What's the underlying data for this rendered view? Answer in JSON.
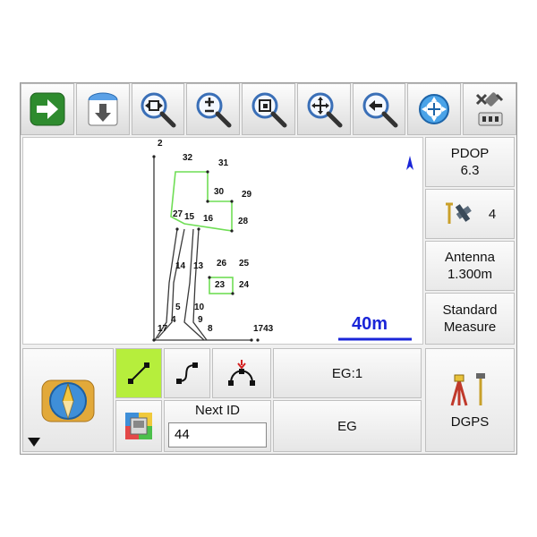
{
  "toolbar": {
    "icons": [
      "exit-arrow-icon",
      "download-icon",
      "zoom-extents-icon",
      "zoom-in-out-icon",
      "zoom-window-icon",
      "pan-icon",
      "zoom-previous-icon",
      "gps-center-icon",
      "gps-settings-icon"
    ]
  },
  "map": {
    "north_marker": "north-arrow-icon",
    "scale_label": "40m",
    "point_labels": [
      "2",
      "32",
      "31",
      "30",
      "29",
      "27",
      "15",
      "16",
      "28",
      "14",
      "13",
      "26",
      "25",
      "23",
      "24",
      "5",
      "10",
      "4",
      "9",
      "17",
      "8",
      "1743"
    ]
  },
  "status": {
    "pdop_label": "PDOP",
    "pdop_value": "6.3",
    "satellite_count": "4",
    "antenna_label": "Antenna",
    "antenna_value": "1.300m",
    "measure_line1": "Standard",
    "measure_line2": "Measure",
    "dgps_label": "DGPS"
  },
  "bottom": {
    "eg_code": "EG:1",
    "eg_name": "EG",
    "next_id_label": "Next ID",
    "next_id_value": "44"
  },
  "colors": {
    "accent_blue": "#1a25d8",
    "polygon_green": "#6fde55",
    "active_green": "#b6ee3c"
  }
}
